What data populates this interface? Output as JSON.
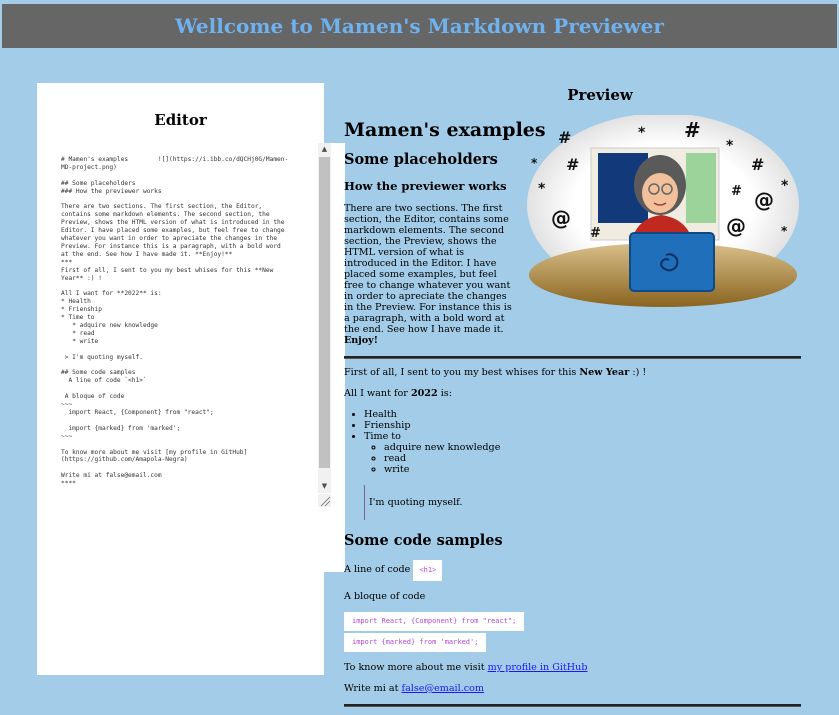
{
  "header": {
    "title": "Wellcome to Mamen's Markdown Previewer"
  },
  "editor": {
    "title": "Editor",
    "content": "# Mamen's examples        ![](https://i.ibb.co/dQCHj0G/Mamen-MD-project.png)\n\n## Some placeholders\n### How the previewer works\n\nThere are two sections. The first section, the Editor, contains some markdown elements. The second section, the Preview, shows the HTML version of what is introduced in the Editor. I have placed some examples, but feel free to change whatever you want in order to apreciate the changes in the Preview. For instance this is a paragraph, with a bold word at the end. See how I have made it. **Enjoy!**\n***\nFirst of all, I sent to you my best whises for this **New Year** :) !\n\nAll I want for **2022** is:\n* Health\n* Frienship\n* Time to\n   * adquire new knowledge\n   * read\n   * write\n\n > I'm quoting myself.\n\n## Some code samples\n  A line of code `<h1>`\n\n A bloque of code\n~~~\n  import React, {Component} from \"react\";\n\n  import {marked} from 'marked';\n~~~\n\nTo know more about me visit [my profile in GitHub](https://github.com/Amapola-Negra)\n\nWrite mi at false@email.com\n****"
  },
  "preview": {
    "title": "Preview",
    "h1": "Mamen's examples",
    "h2": "Some placeholders",
    "h3": "How the previewer works",
    "intro_paragraph": "There are two sections. The first section, the Editor, contains some markdown elements. The second section, the Preview, shows the HTML version of what is introduced in the Editor. I have placed some examples, but feel free to change whatever you want in order to apreciate the changes in the Preview. For instance this is a paragraph, with a bold word at the end. See how I have made it.",
    "intro_bold": "Enjoy!",
    "greeting_before": "First of all, I sent to you my best whises for this",
    "greeting_bold": "New Year",
    "greeting_after": ":) !",
    "want_before": "All I want for",
    "want_bold": "2022",
    "want_after": "is:",
    "list": [
      "Health",
      "Frienship",
      "Time to"
    ],
    "sublist": [
      "adquire new knowledge",
      "read",
      "write"
    ],
    "quote": "I'm quoting myself.",
    "code_heading": "Some code samples",
    "code_line_label": "A line of code",
    "code_inline": "<h1>",
    "code_block_label": "A bloque of code",
    "code_block_lines": [
      "import React, {Component} from \"react\";",
      "import {marked} from 'marked';"
    ],
    "github_before": "To know more about me visit",
    "github_link": "my profile in GitHub",
    "email_before": "Write mi at",
    "email_link": "false@email.com"
  },
  "colors": {
    "background": "#a3cce8",
    "header_bg": "#666666",
    "header_text": "#6fb2f0",
    "code_text": "#b14ad1",
    "link": "#1a1aee"
  },
  "icons": [
    "scroll-up-arrow-icon",
    "scroll-down-arrow-icon",
    "resize-grip-icon"
  ]
}
